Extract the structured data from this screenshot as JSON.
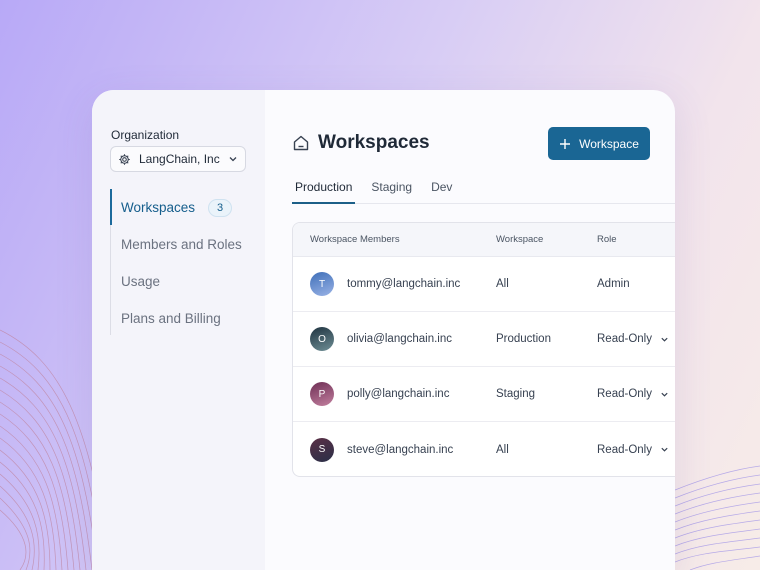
{
  "sidebar": {
    "org_label": "Organization",
    "org_name": "LangChain, Inc",
    "nav": [
      {
        "label": "Workspaces",
        "badge": "3"
      },
      {
        "label": "Members and Roles"
      },
      {
        "label": "Usage"
      },
      {
        "label": "Plans and Billing"
      }
    ]
  },
  "main": {
    "title": "Workspaces",
    "add_button": "Workspace",
    "tabs": [
      "Production",
      "Staging",
      "Dev"
    ],
    "table": {
      "headers": [
        "Workspace Members",
        "Workspace",
        "Role"
      ],
      "rows": [
        {
          "initial": "T",
          "email": "tommy@langchain.inc",
          "workspace": "All",
          "role": "Admin"
        },
        {
          "initial": "O",
          "email": "olivia@langchain.inc",
          "workspace": "Production",
          "role": "Read-Only"
        },
        {
          "initial": "P",
          "email": "polly@langchain.inc",
          "workspace": "Staging",
          "role": "Read-Only"
        },
        {
          "initial": "S",
          "email": "steve@langchain.inc",
          "workspace": "All",
          "role": "Read-Only"
        }
      ]
    }
  },
  "colors": {
    "accent": "#1a6694",
    "avatar_tommy": "#5a7fc0",
    "avatar_olivia": "#2f4f5e",
    "avatar_polly": "#8a3f6a",
    "avatar_steve": "#3a2f48"
  },
  "icons": [
    "gear-icon",
    "chevron-down-icon",
    "home-icon",
    "plus-icon"
  ]
}
